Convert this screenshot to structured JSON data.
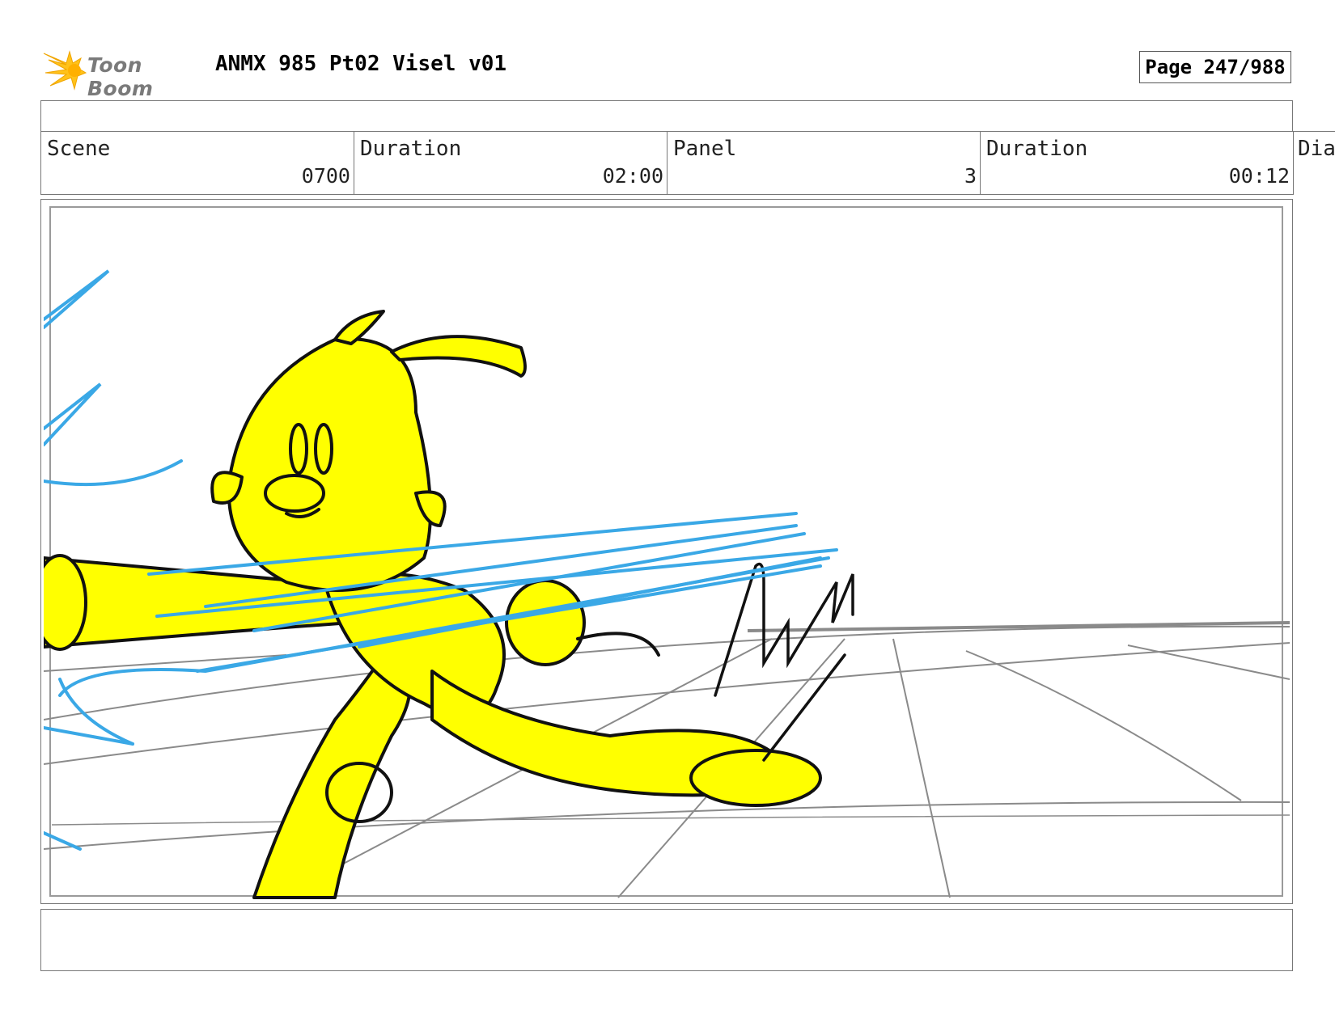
{
  "header": {
    "logo_text": "Toon Boom",
    "document_title": "ANMX 985 Pt02 Visel v01",
    "page_label": "Page 247/988"
  },
  "info": {
    "scene_label": "Scene",
    "scene_value": "0700",
    "scene_duration_label": "Duration",
    "scene_duration_value": "02:00",
    "panel_label": "Panel",
    "panel_value": "3",
    "panel_duration_label": "Duration",
    "panel_duration_value": "00:12",
    "dialogue_label": "Dia"
  },
  "panel": {
    "description": "",
    "colors": {
      "character": "#ffff00",
      "speed_lines": "#3aa8e6",
      "floor_grid": "#8a8a8a",
      "ink": "#111111"
    }
  },
  "caption": {
    "text": ""
  }
}
